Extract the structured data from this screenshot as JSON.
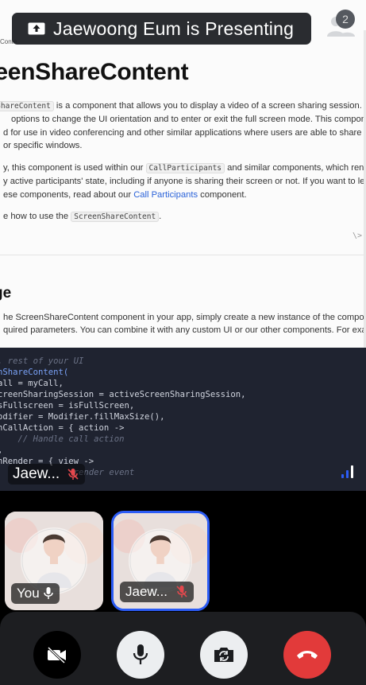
{
  "banner": {
    "text": "Jaewoong Eum is Presenting",
    "participant_count": "2"
  },
  "doc": {
    "breadcrumb": "Conte",
    "title": "reenShareContent",
    "para1": [
      {
        "pre": "",
        "code": "eenShareContent",
        "post": " is a component that allows you to display a video of a screen sharing session. It"
      },
      {
        "pre": "options to change the UI orientation and to enter or exit the full screen mode. This component is",
        "code": "",
        "post": ""
      },
      {
        "pre": "d for use in video conferencing and other similar applications where users are able to share their en",
        "code": "",
        "post": ""
      },
      {
        "pre": "or specific windows.",
        "code": "",
        "post": ""
      }
    ],
    "para2": {
      "l1_pre": "y, this component is used within our ",
      "l1_code": "CallParticipants",
      "l1_post": " and similar components, which render the",
      "l2": "y active participants' state, including if anyone is sharing their screen or not. If you want to learn mo",
      "l3_pre": "ese components, read about our ",
      "l3_link": "Call Participants",
      "l3_post": " component."
    },
    "para3": {
      "pre": "e how to use the ",
      "code": "ScreenShareContent",
      "post": "."
    },
    "code_ref": "\\>",
    "usage_title": "ge",
    "usage_text": [
      "he ScreenShareContent component in your app, simply create a new instance of the component an",
      "quired parameters. You can combine it with any custom UI or our other components. For example:"
    ],
    "code_lines": [
      ". rest of your UI",
      "nShareContent(",
      "all = myCall,",
      "creenSharingSession = activeScreenSharingSession,",
      "sFullscreen = isFullScreen,",
      "odifier = Modifier.fillMaxSize(),",
      "nCallAction = { action ->",
      "    // Handle call action",
      ",",
      "nRender = { view ->",
      "               render event"
    ]
  },
  "presenter_label": "Jaew...",
  "tiles": [
    {
      "name": "You",
      "mic": "on"
    },
    {
      "name": "Jaew...",
      "mic": "muted"
    }
  ],
  "controls": {
    "camera": "camera-off",
    "mic": "microphone",
    "flip": "flip-camera",
    "hangup": "end-call"
  },
  "colors": {
    "accent": "#2c5cf5",
    "hangup": "#e23a3a",
    "mute": "#e5484d"
  }
}
